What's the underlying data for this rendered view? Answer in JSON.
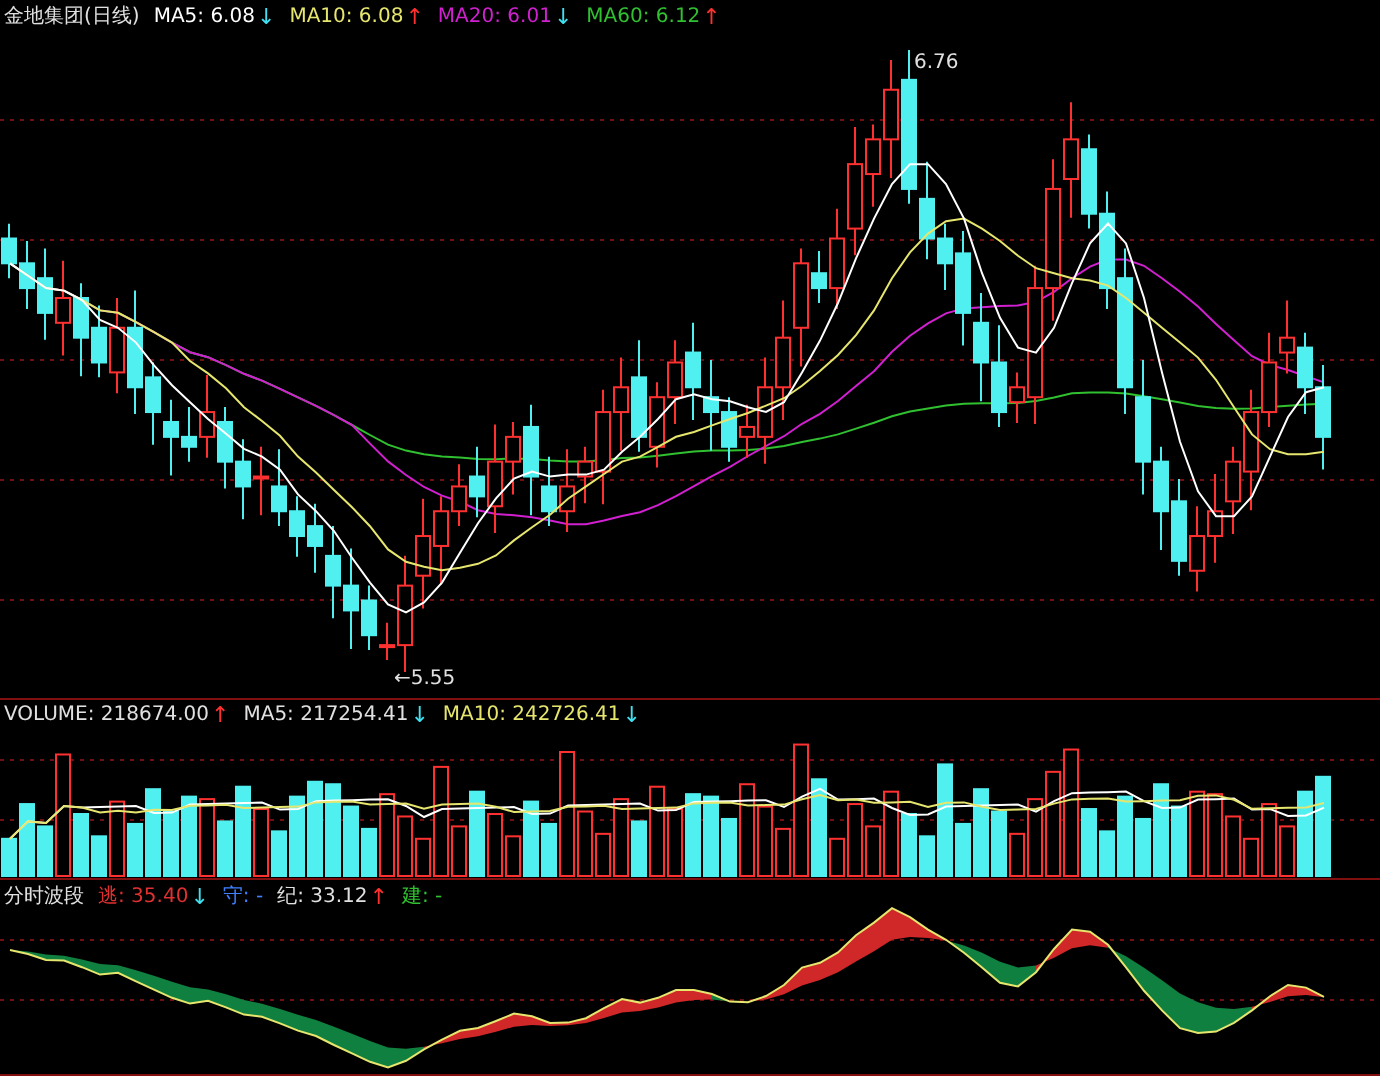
{
  "price_panel": {
    "title": "金地集团(日线)",
    "averages": [
      {
        "label": "MA5: 6.08",
        "color": "#ffffff",
        "arrow": "↓",
        "rising": false
      },
      {
        "label": "MA10: 6.08",
        "color": "#e6e66e",
        "arrow": "↑",
        "rising": true
      },
      {
        "label": "MA20: 6.01",
        "color": "#d020d0",
        "arrow": "↓",
        "rising": false
      },
      {
        "label": "MA60: 6.12",
        "color": "#30c030",
        "arrow": "↑",
        "rising": true
      }
    ],
    "high_marker": "6.76",
    "low_marker": "←5.55"
  },
  "volume_panel": {
    "readings": [
      {
        "label": "VOLUME: 218674.00",
        "color": "#e0e0e0",
        "arrow": "↑",
        "rising": true
      },
      {
        "label": "MA5: 217254.41",
        "color": "#e0e0e0",
        "arrow": "↓",
        "rising": false
      },
      {
        "label": "MA10: 242726.41",
        "color": "#e6e66e",
        "arrow": "↓",
        "rising": false
      }
    ]
  },
  "indicator_panel": {
    "title": "分时波段",
    "readings": [
      {
        "label": "逃: 35.40",
        "color": "#e03030",
        "arrow": "↓",
        "rising": false
      },
      {
        "label": "守: -",
        "color": "#4080ff"
      },
      {
        "label": "纪: 33.12",
        "color": "#e0e0e0",
        "arrow": "↑",
        "rising": true
      },
      {
        "label": "建: -",
        "color": "#30c030"
      }
    ]
  }
}
